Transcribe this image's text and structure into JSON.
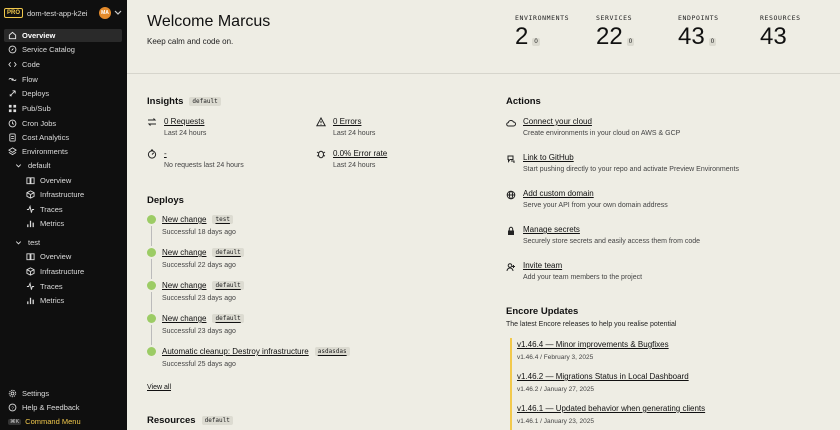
{
  "app": {
    "plan_badge": "PRO",
    "name": "dom-test-app-k2ei",
    "avatar_initials": "MA"
  },
  "sidebar": {
    "items": [
      {
        "label": "Overview",
        "icon": "home-icon",
        "active": true
      },
      {
        "label": "Service Catalog",
        "icon": "compass-icon"
      },
      {
        "label": "Code",
        "icon": "code-icon"
      },
      {
        "label": "Flow",
        "icon": "flow-icon"
      },
      {
        "label": "Deploys",
        "icon": "rocket-icon"
      },
      {
        "label": "Pub/Sub",
        "icon": "pubsub-icon"
      },
      {
        "label": "Cron Jobs",
        "icon": "clock-icon"
      },
      {
        "label": "Cost Analytics",
        "icon": "cost-icon"
      },
      {
        "label": "Environments",
        "icon": "layers-icon"
      }
    ],
    "environments": [
      {
        "name": "default",
        "items": [
          {
            "label": "Overview",
            "icon": "book-icon"
          },
          {
            "label": "Infrastructure",
            "icon": "cube-icon"
          },
          {
            "label": "Traces",
            "icon": "activity-icon"
          },
          {
            "label": "Metrics",
            "icon": "bar-chart-icon"
          }
        ]
      },
      {
        "name": "test",
        "items": [
          {
            "label": "Overview",
            "icon": "book-icon"
          },
          {
            "label": "Infrastructure",
            "icon": "cube-icon"
          },
          {
            "label": "Traces",
            "icon": "activity-icon"
          },
          {
            "label": "Metrics",
            "icon": "bar-chart-icon"
          }
        ]
      }
    ],
    "footer": [
      {
        "label": "Settings",
        "icon": "gear-icon"
      },
      {
        "label": "Help & Feedback",
        "icon": "help-icon"
      }
    ],
    "command_menu": {
      "shortcut": "⌘K",
      "label": "Command Menu"
    }
  },
  "header": {
    "title": "Welcome Marcus",
    "tagline": "Keep calm and code on.",
    "stats": [
      {
        "label": "ENVIRONMENTS",
        "value": "2",
        "badge": "0"
      },
      {
        "label": "SERVICES",
        "value": "22",
        "badge": "0"
      },
      {
        "label": "ENDPOINTS",
        "value": "43",
        "badge": "0"
      },
      {
        "label": "RESOURCES",
        "value": "43",
        "badge": ""
      }
    ]
  },
  "insights": {
    "title": "Insights",
    "env_tag": "default",
    "items": [
      {
        "title": "0 Requests",
        "sub": "Last 24 hours",
        "icon": "arrows-icon"
      },
      {
        "title": "0 Errors",
        "sub": "Last 24 hours",
        "icon": "warning-icon"
      },
      {
        "title": "-",
        "sub": "No requests last 24 hours",
        "icon": "timer-icon"
      },
      {
        "title": "0.0% Error rate",
        "sub": "Last 24 hours",
        "icon": "bug-icon"
      }
    ]
  },
  "deploys": {
    "title": "Deploys",
    "items": [
      {
        "title": "New change",
        "tag": "test",
        "status": "Successful 18 days ago"
      },
      {
        "title": "New change",
        "tag": "default",
        "status": "Successful 22 days ago"
      },
      {
        "title": "New change",
        "tag": "default",
        "status": "Successful 23 days ago"
      },
      {
        "title": "New change",
        "tag": "default",
        "status": "Successful 23 days ago"
      },
      {
        "title": "Automatic cleanup: Destroy infrastructure",
        "tag": "asdasdas",
        "status": "Successful 25 days ago"
      }
    ],
    "view_all": "View all"
  },
  "resources": {
    "title": "Resources",
    "env_tag": "default"
  },
  "actions": {
    "title": "Actions",
    "items": [
      {
        "title": "Connect your cloud",
        "sub": "Create environments in your cloud on AWS & GCP",
        "icon": "cloud-icon"
      },
      {
        "title": "Link to GitHub",
        "sub": "Start pushing directly to your repo and activate Preview Environments",
        "icon": "github-icon"
      },
      {
        "title": "Add custom domain",
        "sub": "Serve your API from your own domain address",
        "icon": "globe-icon"
      },
      {
        "title": "Manage secrets",
        "sub": "Securely store secrets and easily access them from code",
        "icon": "lock-icon"
      },
      {
        "title": "Invite team",
        "sub": "Add your team members to the project",
        "icon": "user-plus-icon"
      }
    ]
  },
  "updates": {
    "title": "Encore Updates",
    "subtitle": "The latest Encore releases to help you realise potential",
    "items": [
      {
        "title": "v1.46.4 — Minor improvements & Bugfixes",
        "meta": "v1.46.4 / February 3, 2025"
      },
      {
        "title": "v1.46.2 — Migrations Status in Local Dashboard",
        "meta": "v1.46.2 / January 27, 2025"
      },
      {
        "title": "v1.46.1 — Updated behavior when generating clients",
        "meta": "v1.46.1 / January 23, 2025"
      }
    ]
  },
  "colors": {
    "sidebar_bg": "#0f0f0f",
    "page_bg": "#eeede4",
    "accent": "#f2c94c",
    "success": "#9ccc65"
  }
}
